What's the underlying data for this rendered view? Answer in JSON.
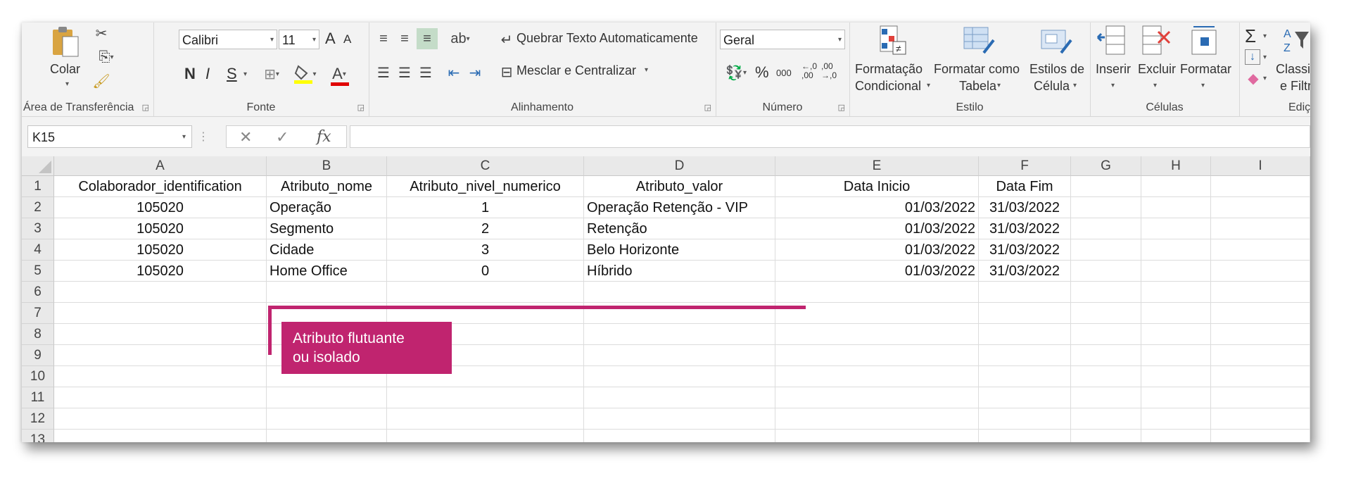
{
  "ribbon": {
    "clipboard": {
      "paste_label": "Colar",
      "group_label": "Área de Transferência"
    },
    "font": {
      "name": "Calibri",
      "size": "11",
      "bold": "N",
      "italic": "I",
      "underline": "S",
      "group_label": "Fonte",
      "grow": "A",
      "shrink": "A",
      "font_color_glyph": "A"
    },
    "alignment": {
      "wrap_label": "Quebrar Texto Automaticamente",
      "merge_label": "Mesclar e Centralizar",
      "group_label": "Alinhamento"
    },
    "number": {
      "format": "Geral",
      "percent": "%",
      "thousands": "000",
      "inc_dec": "←,0\n,00",
      "dec_dec": ",00\n→,0",
      "group_label": "Número"
    },
    "styles": {
      "cond_line1": "Formatação",
      "cond_line2": "Condicional",
      "table_line1": "Formatar como",
      "table_line2": "Tabela",
      "cell_line1": "Estilos de",
      "cell_line2": "Célula",
      "group_label": "Estilo"
    },
    "cells": {
      "insert": "Inserir",
      "delete": "Excluir",
      "format": "Formatar",
      "group_label": "Células"
    },
    "editing": {
      "sort_line1": "Classificar",
      "sort_line2": "e Filtrar",
      "sigma": "Σ",
      "group_label": "Ediçã"
    }
  },
  "formula_bar": {
    "name_box": "K15",
    "fx": "fx",
    "formula": ""
  },
  "columns": [
    "A",
    "B",
    "C",
    "D",
    "E",
    "F",
    "G",
    "H",
    "I"
  ],
  "rows": [
    "1",
    "2",
    "3",
    "4",
    "5",
    "6",
    "7",
    "8",
    "9",
    "10",
    "11",
    "12",
    "13"
  ],
  "table": {
    "headers": [
      "Colaborador_identification",
      "Atributo_nome",
      "Atributo_nivel_numerico",
      "Atributo_valor",
      "Data Inicio",
      "Data Fim"
    ],
    "data": [
      [
        "105020",
        "Operação",
        "1",
        "Operação Retenção - VIP",
        "01/03/2022",
        "31/03/2022"
      ],
      [
        "105020",
        "Segmento",
        "2",
        "Retenção",
        "01/03/2022",
        "31/03/2022"
      ],
      [
        "105020",
        "Cidade",
        "3",
        "Belo Horizonte",
        "01/03/2022",
        "31/03/2022"
      ],
      [
        "105020",
        "Home Office",
        "0",
        "Híbrido",
        "01/03/2022",
        "31/03/2022"
      ]
    ]
  },
  "annotation": {
    "line1": "Atributo flutuante",
    "line2": "ou isolado",
    "color": "#c0246f"
  }
}
